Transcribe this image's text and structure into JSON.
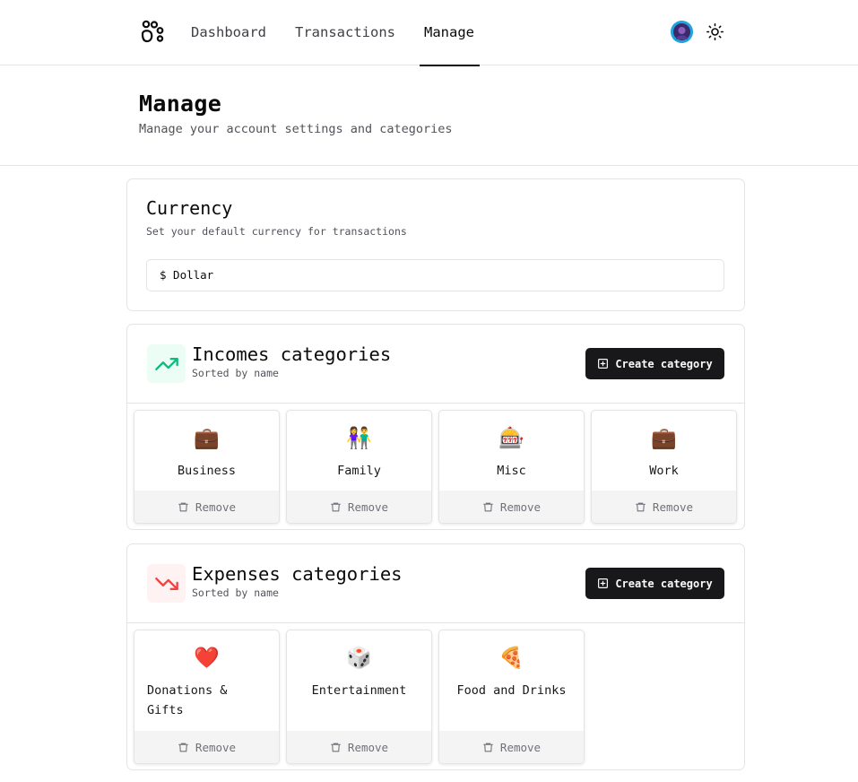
{
  "nav": {
    "items": [
      {
        "label": "Dashboard"
      },
      {
        "label": "Transactions"
      },
      {
        "label": "Manage"
      }
    ],
    "active": "Manage"
  },
  "header": {
    "title": "Manage",
    "subtitle": "Manage your account settings and categories"
  },
  "currency": {
    "title": "Currency",
    "description": "Set your default currency for transactions",
    "selected": "$ Dollar"
  },
  "incomes": {
    "title": "Incomes categories",
    "subtitle": "Sorted by name",
    "create_label": "Create category",
    "icon": "trending-up-icon",
    "accent": "#10b981",
    "categories": [
      {
        "emoji": "💼",
        "name": "Business",
        "remove": "Remove"
      },
      {
        "emoji": "👫",
        "name": "Family",
        "remove": "Remove"
      },
      {
        "emoji": "🎰",
        "name": "Misc",
        "remove": "Remove"
      },
      {
        "emoji": "💼",
        "name": "Work",
        "remove": "Remove"
      }
    ]
  },
  "expenses": {
    "title": "Expenses categories",
    "subtitle": "Sorted by name",
    "create_label": "Create category",
    "icon": "trending-down-icon",
    "accent": "#ef4444",
    "categories": [
      {
        "emoji": "❤️",
        "name": "Donations & Gifts",
        "remove": "Remove"
      },
      {
        "emoji": "🎲",
        "name": "Entertainment",
        "remove": "Remove"
      },
      {
        "emoji": "🍕",
        "name": "Food and Drinks",
        "remove": "Remove"
      }
    ]
  }
}
